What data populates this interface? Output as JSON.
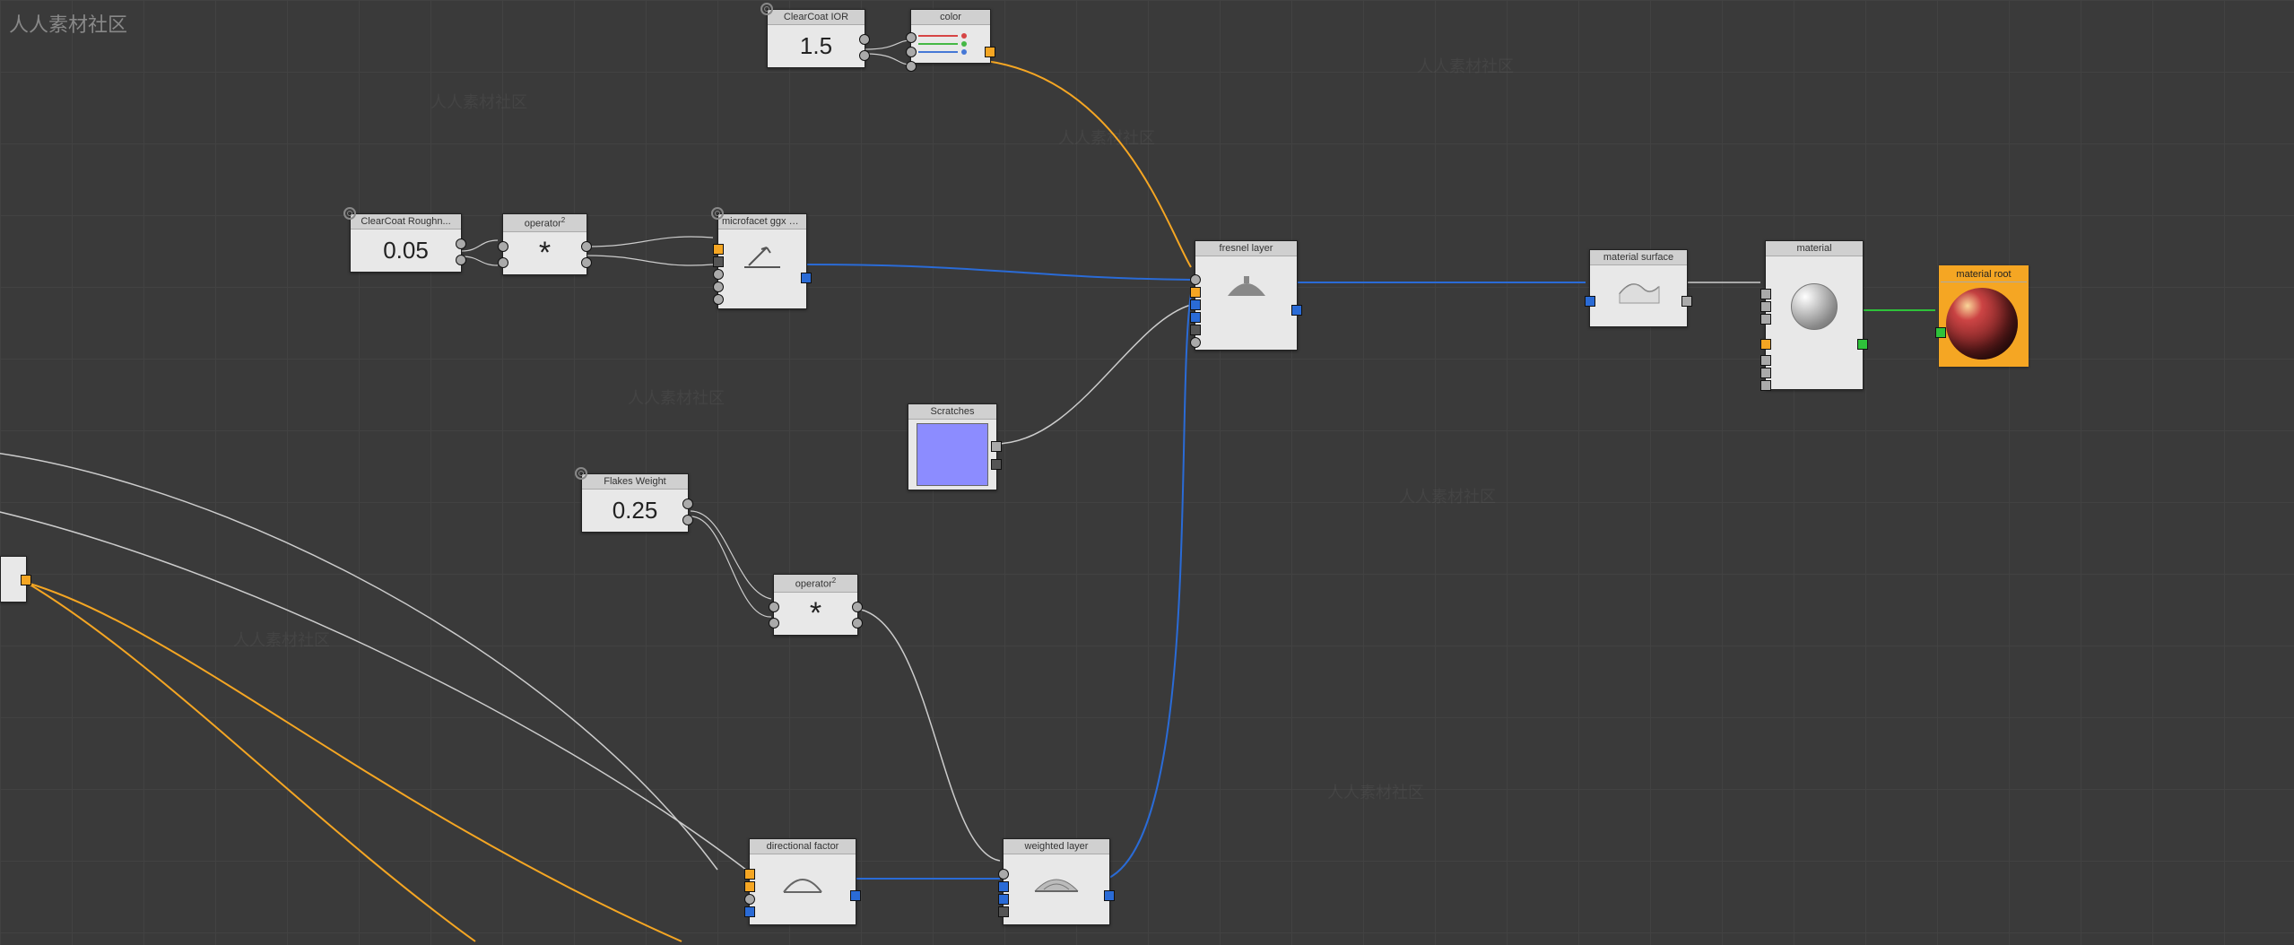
{
  "watermark": "人人素材社区",
  "nodes": {
    "clearcoat_ior": {
      "title": "ClearCoat IOR",
      "value": "1.5"
    },
    "color": {
      "title": "color",
      "rows": [
        "#d64545",
        "#45b845",
        "#4578d6"
      ]
    },
    "clearcoat_rough": {
      "title": "ClearCoat Roughn...",
      "value": "0.05"
    },
    "operator1": {
      "title": "operator",
      "op": "*"
    },
    "microfacet": {
      "title": "microfacet ggx sm..."
    },
    "fresnel": {
      "title": "fresnel layer"
    },
    "material_surface": {
      "title": "material surface"
    },
    "material": {
      "title": "material"
    },
    "material_root": {
      "title": "material root"
    },
    "scratches": {
      "title": "Scratches"
    },
    "flakes_weight": {
      "title": "Flakes Weight",
      "value": "0.25"
    },
    "operator2": {
      "title": "operator",
      "op": "*"
    },
    "directional": {
      "title": "directional factor"
    },
    "weighted": {
      "title": "weighted layer"
    }
  }
}
